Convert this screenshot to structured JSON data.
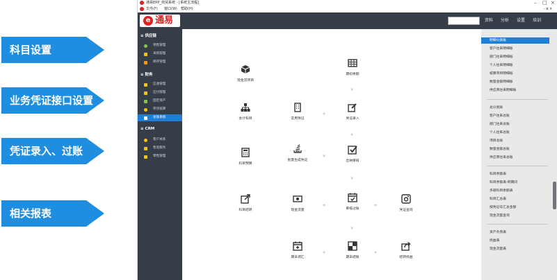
{
  "callouts": [
    {
      "label": "科目设置"
    },
    {
      "label": "业务凭证接口设置"
    },
    {
      "label": "凭证录入、过账"
    },
    {
      "label": "相关报表"
    }
  ],
  "callout_color": "#1f8de0",
  "window": {
    "title": "通易ERP_商贸系统 - [系统主流程]",
    "menus": [
      "文件(F)",
      "窗口(W)",
      "帮助(H)"
    ],
    "controls": [
      "–",
      "□",
      "×"
    ],
    "sub_controls": [
      "- ø ×"
    ]
  },
  "appbar": {
    "logo_text": "通易",
    "nav": [
      "资料",
      "分析",
      "设置",
      "培训"
    ]
  },
  "sidebar": {
    "sections": [
      {
        "title": "供应链",
        "items": [
          {
            "label": "销售管理",
            "icon": "cart-icon",
            "color": "#8bc34a"
          },
          {
            "label": "采购管理",
            "icon": "truck-icon",
            "color": "#ffc107"
          },
          {
            "label": "库存管理",
            "icon": "home-icon",
            "color": "#ff9800"
          }
        ]
      },
      {
        "title": "财务",
        "items": [
          {
            "label": "应收管理",
            "icon": "inbox-icon",
            "color": "#ffc107"
          },
          {
            "label": "应付管理",
            "icon": "card-icon",
            "color": "#ffc107"
          },
          {
            "label": "固定资产",
            "icon": "sitemap-icon",
            "color": "#8bc34a"
          },
          {
            "label": "存货核算",
            "icon": "clock-icon",
            "color": "#ffc107"
          },
          {
            "label": "总账系统",
            "icon": "ledger-icon",
            "color": "#ffffff",
            "active": true
          }
        ]
      },
      {
        "title": "CRM",
        "items": [
          {
            "label": "客户关系",
            "icon": "users-icon",
            "color": "#ffc107"
          },
          {
            "label": "售后服务",
            "icon": "service-icon",
            "color": "#ffc107"
          },
          {
            "label": "零售管理",
            "icon": "retail-icon",
            "color": "#ffc107"
          }
        ]
      }
    ]
  },
  "flow": {
    "nodes": {
      "xjllxm": "现金流项目",
      "qcye": "期初余额",
      "kjkm": "会计科目",
      "cypz": "常用凭证",
      "pzlr": "凭证录入",
      "kmys": "科目预算",
      "plscpz": "批量生成凭证",
      "cnsh": "出纳审核",
      "kmjz": "科目结转",
      "xjll": "现金流量",
      "shgz": "审核过账",
      "pzcx": "凭证查询",
      "qmth": "期末调汇",
      "qmjz": "期末结账",
      "jzsy": "结转损益"
    },
    "arrow_right": "»",
    "arrow_down": "»",
    "arrow_left": "«"
  },
  "right_panel": {
    "groups": [
      [
        "明细分类账",
        "客户往来明细账",
        "部门往来明细账",
        "个人往来明细账",
        "核算项目明细账",
        "数量金额明细账",
        "供应商往来明细账"
      ],
      [
        "总分类账",
        "客户往来总账",
        "部门往来总账",
        "个人往来总账",
        "项目总账",
        "数量金额总账",
        "供应商往来总账"
      ],
      [
        "科目余额表",
        "科目余额表-跨期间",
        "多级科目余额表",
        "科目汇总表",
        "按凭证号汇总金额",
        "现金流量查询"
      ],
      [
        "资产负债表",
        "损益表",
        "现金流量表"
      ]
    ]
  },
  "colors": {
    "dark": "#343d48",
    "accent": "#1f7fd6",
    "brand_red": "#e02020",
    "panel": "#e9e9e9"
  }
}
